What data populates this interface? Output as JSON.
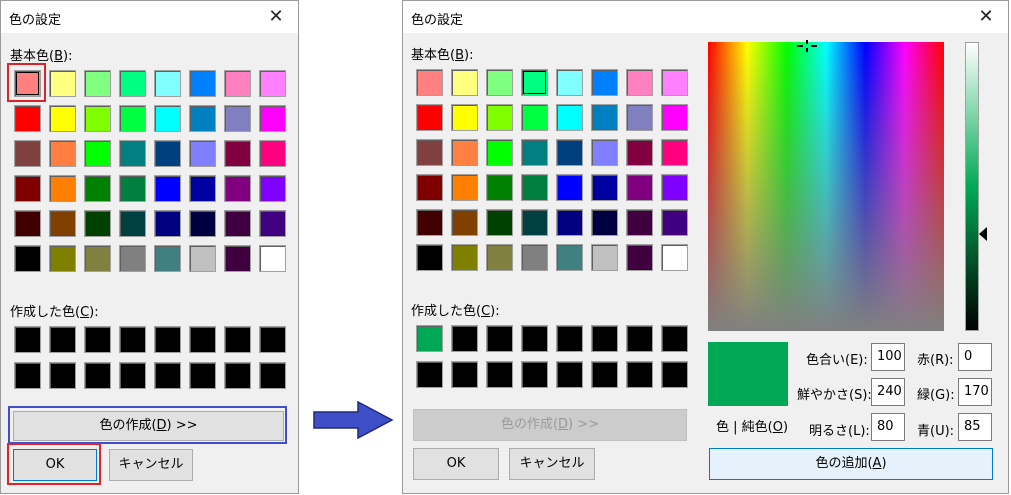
{
  "left_dialog": {
    "title": "色の設定",
    "basic_label_prefix": "基本色(",
    "basic_label_key": "B",
    "basic_label_suffix": "):",
    "custom_label_prefix": "作成した色(",
    "custom_label_key": "C",
    "custom_label_suffix": "):",
    "define_button_prefix": "色の作成(",
    "define_button_key": "D",
    "define_button_suffix": ") >>",
    "ok_label": "OK",
    "cancel_label": "キャンセル"
  },
  "right_dialog": {
    "title": "色の設定",
    "basic_label_prefix": "基本色(",
    "basic_label_key": "B",
    "basic_label_suffix": "):",
    "custom_label_prefix": "作成した色(",
    "custom_label_key": "C",
    "custom_label_suffix": "):",
    "define_button_prefix": "色の作成(",
    "define_button_key": "D",
    "define_button_suffix": ") >>",
    "ok_label": "OK",
    "cancel_label": "キャンセル",
    "solid_label_prefix": "色 | 純色(",
    "solid_label_key": "O",
    "solid_label_suffix": ")",
    "hue_label": "色合い(E):",
    "hue_value": "100",
    "sat_label": "鮮やかさ(S):",
    "sat_value": "240",
    "lum_label": "明るさ(L):",
    "lum_value": "80",
    "red_label": "赤(R):",
    "red_value": "0",
    "green_label": "緑(G):",
    "green_value": "170",
    "blue_label": "青(U):",
    "blue_value": "85",
    "add_button_prefix": "色の追加(",
    "add_button_key": "A",
    "add_button_suffix": ")",
    "preview_color": "#00a755"
  },
  "basic_colors": [
    "#ff8080",
    "#ffff80",
    "#80ff80",
    "#00ff80",
    "#80ffff",
    "#0080ff",
    "#ff80c0",
    "#ff80ff",
    "#ff0000",
    "#ffff00",
    "#80ff00",
    "#00ff40",
    "#00ffff",
    "#0080c0",
    "#8080c0",
    "#ff00ff",
    "#804040",
    "#ff8040",
    "#00ff00",
    "#008080",
    "#004080",
    "#8080ff",
    "#800040",
    "#ff0080",
    "#800000",
    "#ff8000",
    "#008000",
    "#008040",
    "#0000ff",
    "#0000a0",
    "#800080",
    "#8000ff",
    "#400000",
    "#804000",
    "#004000",
    "#004040",
    "#000080",
    "#000040",
    "#400040",
    "#400080",
    "#000000",
    "#808000",
    "#808040",
    "#808080",
    "#408080",
    "#c0c0c0",
    "#400040",
    "#ffffff"
  ],
  "left_custom_colors": [
    "#000000",
    "#000000",
    "#000000",
    "#000000",
    "#000000",
    "#000000",
    "#000000",
    "#000000",
    "#000000",
    "#000000",
    "#000000",
    "#000000",
    "#000000",
    "#000000",
    "#000000",
    "#000000"
  ],
  "right_custom_colors": [
    "#00a755",
    "#000000",
    "#000000",
    "#000000",
    "#000000",
    "#000000",
    "#000000",
    "#000000",
    "#000000",
    "#000000",
    "#000000",
    "#000000",
    "#000000",
    "#000000",
    "#000000",
    "#000000"
  ],
  "colors": {
    "highlight_red": "#e0232b",
    "highlight_blue": "#3f4fc8",
    "arrow_blue": "#3f4fc8"
  }
}
